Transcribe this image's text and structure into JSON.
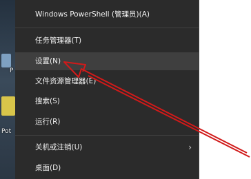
{
  "desktop": {
    "icon_label_top": "P",
    "icon_label_bottom": "Pot"
  },
  "menu": {
    "items": [
      {
        "label": "Windows PowerShell (管理员)(A)"
      },
      {
        "label": "任务管理器(T)"
      },
      {
        "label": "设置(N)"
      },
      {
        "label": "文件资源管理器(E)"
      },
      {
        "label": "搜索(S)"
      },
      {
        "label": "运行(R)"
      },
      {
        "label": "关机或注销(U)"
      },
      {
        "label": "桌面(D)"
      }
    ],
    "submenu_glyph": "›",
    "highlighted_item": "设置(N)"
  },
  "annotation": {
    "arrow_color": "#d11a1a",
    "arrow_icon": "red-pointer-arrow-icon"
  }
}
